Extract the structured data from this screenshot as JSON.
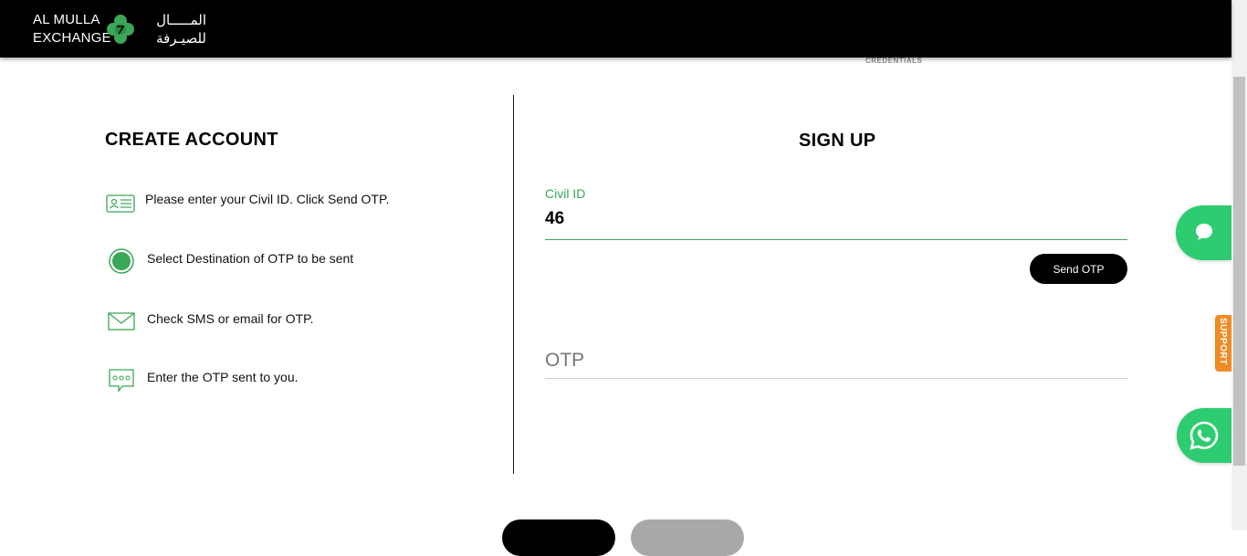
{
  "brand": {
    "name_line1": "AL MULLA",
    "name_line2": "EXCHANGE",
    "name_ar_line1": "المـــــال",
    "name_ar_line2": "للصيـرفة",
    "logo_icon": "clover-logo-icon",
    "accent_color": "#3aa757"
  },
  "progress": {
    "step_caption": "CREDENTIALS"
  },
  "create_account": {
    "title": "CREATE ACCOUNT",
    "steps": [
      {
        "icon": "id-card-icon",
        "text": "Please enter your Civil ID. Click Send OTP."
      },
      {
        "icon": "radio-selected-icon",
        "text": "Select Destination of OTP to be sent"
      },
      {
        "icon": "envelope-icon",
        "text": "Check SMS or email for OTP."
      },
      {
        "icon": "chat-bubble-dots-icon",
        "text": "Enter the OTP sent to you."
      }
    ]
  },
  "signup": {
    "title": "SIGN UP",
    "civil_id": {
      "label": "Civil ID",
      "value": "46"
    },
    "send_otp_label": "Send OTP",
    "otp": {
      "placeholder": "OTP",
      "value": ""
    }
  },
  "floating": {
    "chat_icon": "chat-icon",
    "support_label": "SUPPORT",
    "whatsapp_icon": "whatsapp-icon",
    "chat_color": "#2ecc71",
    "support_color": "#f08a24"
  }
}
